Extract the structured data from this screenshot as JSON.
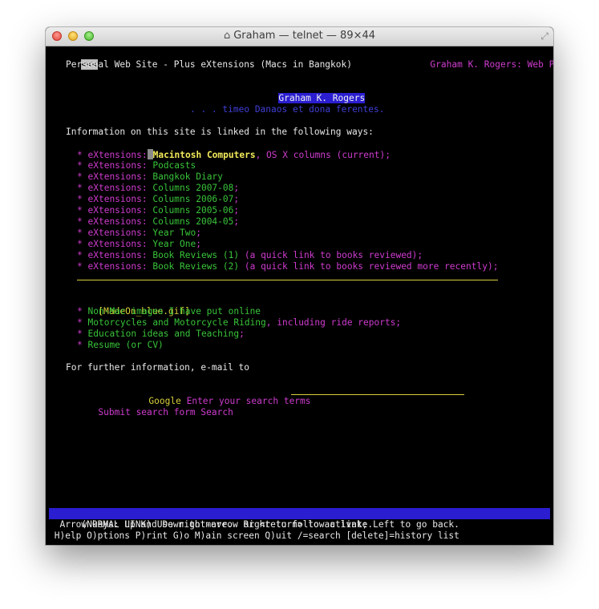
{
  "window": {
    "title": "Graham — telnet — 89×44",
    "icons": [
      "home-icon",
      "fullscreen-icon"
    ]
  },
  "top": {
    "back": "<<<",
    "page_link": "Graham K. Rogers: Web Pages"
  },
  "site_title": "Personal Web Site - Plus eXtensions (Macs in Bangkok)",
  "heading": "Graham K. Rogers",
  "motto": ". . . timeo Danaos et dona ferentes.",
  "intro": "Information on this site is linked in the following ways:",
  "bullet": "*",
  "ext_prefix": "eXtensions:",
  "ext_items": [
    {
      "link": "Macintosh Computers",
      "rest": ", OS X columns (current);"
    },
    {
      "link": "Podcasts",
      "rest": ""
    },
    {
      "link": "Bangkok Diary",
      "rest": ""
    },
    {
      "link": "Columns 2007-08",
      "rest": ";"
    },
    {
      "link": "Columns 2006-07",
      "rest": ";"
    },
    {
      "link": "Columns 2005-06",
      "rest": ";"
    },
    {
      "link": "Columns 2004-05",
      "rest": ";"
    },
    {
      "link": "Year Two",
      "rest": ";"
    },
    {
      "link": "Year One",
      "rest": ";"
    },
    {
      "link": "Book Reviews (1)",
      "rest": " (a quick link to books reviewed);"
    },
    {
      "link": "Book Reviews (2)",
      "rest": " (a quick link to books reviewed more recently);"
    }
  ],
  "made_on": "[MadeOn_blue.gif]",
  "other_items": [
    {
      "link": "Non-Mac images I have put online",
      "rest": ""
    },
    {
      "link": "Motorcycles and Motorcycle Riding",
      "rest": ", including ride reports;"
    },
    {
      "link": "Education ideas and Teaching",
      "rest": ";"
    },
    {
      "link": "Resume (or CV)",
      "rest": ""
    }
  ],
  "contact": "For further information, e-mail to",
  "search": {
    "google": "Google",
    "prompt": "Enter your search terms",
    "submit": "Submit search form Search"
  },
  "status": {
    "line1": "(NORMAL LINK) Use right-arrow or <return> to activate.",
    "line2": "  Arrow keys: Up and Down to move.  Right to follow a link; Left to go back.",
    "line3": " H)elp O)ptions P)rint G)o M)ain screen Q)uit /=search [delete]=history list"
  },
  "colors": {
    "link": "#39c43a",
    "label": "#cf3ccf",
    "rule": "#d8cf3a",
    "highlight": "#2a1ed0",
    "motto": "#3f3fd6"
  }
}
